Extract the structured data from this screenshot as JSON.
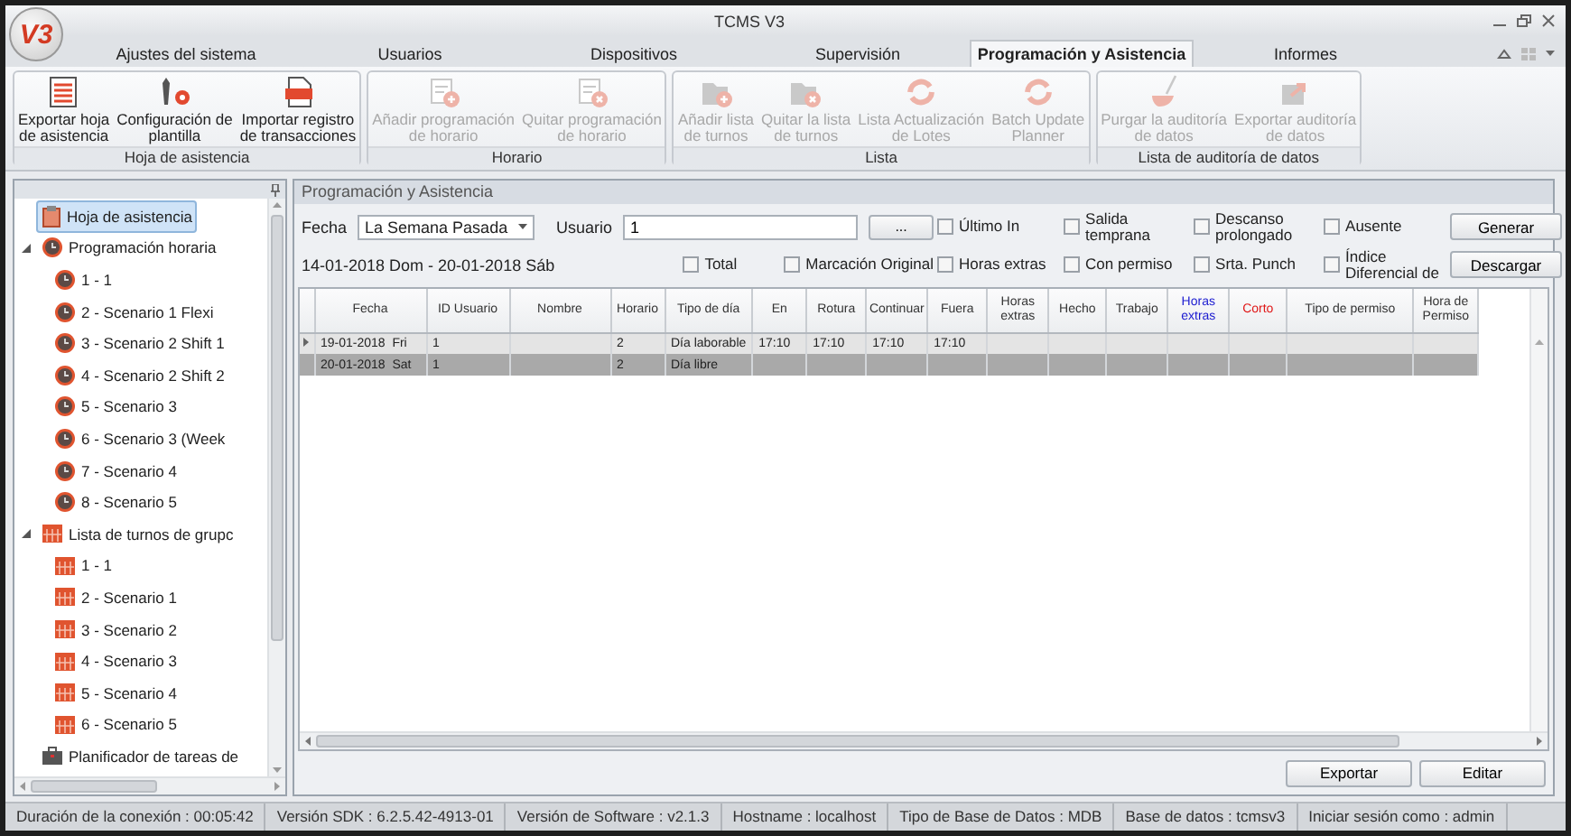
{
  "window": {
    "logo": "V3",
    "title": "TCMS V3"
  },
  "tabs": [
    {
      "label": "Ajustes del sistema",
      "selected": false
    },
    {
      "label": "Usuarios",
      "selected": false
    },
    {
      "label": "Dispositivos",
      "selected": false
    },
    {
      "label": "Supervisión",
      "selected": false
    },
    {
      "label": "Programación y Asistencia",
      "selected": true
    },
    {
      "label": "Informes",
      "selected": false
    }
  ],
  "ribbon": [
    {
      "label": "Hoja de asistencia",
      "buttons": [
        {
          "lines": [
            "Exportar hoja",
            "de asistencia"
          ],
          "kind": "sheet",
          "disabled": false
        },
        {
          "lines": [
            "Configuración de",
            "plantilla"
          ],
          "kind": "tools",
          "disabled": false
        },
        {
          "lines": [
            "Importar registro",
            "de transacciones"
          ],
          "kind": "log",
          "disabled": false
        }
      ]
    },
    {
      "label": "Horario",
      "buttons": [
        {
          "lines": [
            "Añadir programación",
            "de horario"
          ],
          "kind": "doc-add",
          "disabled": true
        },
        {
          "lines": [
            "Quitar programación",
            "de horario"
          ],
          "kind": "doc-remove",
          "disabled": true
        }
      ]
    },
    {
      "label": "Lista",
      "buttons": [
        {
          "lines": [
            "Añadir lista",
            "de turnos"
          ],
          "kind": "folder-add",
          "disabled": true
        },
        {
          "lines": [
            "Quitar la lista",
            "de turnos"
          ],
          "kind": "folder-remove",
          "disabled": true
        },
        {
          "lines": [
            "Lista Actualización",
            "de Lotes"
          ],
          "kind": "refresh",
          "disabled": true
        },
        {
          "lines": [
            "Batch Update",
            "Planner"
          ],
          "kind": "refresh",
          "disabled": true
        }
      ]
    },
    {
      "label": "Lista de auditoría de datos",
      "buttons": [
        {
          "lines": [
            "Purgar la auditoría",
            "de datos"
          ],
          "kind": "broom",
          "disabled": true
        },
        {
          "lines": [
            "Exportar auditoría",
            "de datos"
          ],
          "kind": "export",
          "disabled": true
        }
      ]
    }
  ],
  "sidebar": {
    "items": [
      {
        "label": "Hoja de asistencia",
        "kind": "sheet",
        "selected": true
      },
      {
        "label": "Programación horaria",
        "kind": "clock",
        "selected": false,
        "expanded": true,
        "children": [
          {
            "label": "1 - 1",
            "kind": "clock",
            "selected": false
          },
          {
            "label": "2 - Scenario 1 Flexi",
            "kind": "clock",
            "selected": false
          },
          {
            "label": "3 - Scenario 2 Shift 1",
            "kind": "clock",
            "selected": false
          },
          {
            "label": "4 - Scenario 2 Shift 2",
            "kind": "clock",
            "selected": false
          },
          {
            "label": "5 - Scenario 3",
            "kind": "clock",
            "selected": false
          },
          {
            "label": "6 - Scenario 3 (Week",
            "kind": "clock",
            "selected": false
          },
          {
            "label": "7 - Scenario 4",
            "kind": "clock",
            "selected": false
          },
          {
            "label": "8 - Scenario 5",
            "kind": "clock",
            "selected": false
          }
        ]
      },
      {
        "label": "Lista de turnos de grupc",
        "kind": "calendar",
        "selected": false,
        "expanded": true,
        "children": [
          {
            "label": "1 - 1",
            "kind": "calendar",
            "selected": false
          },
          {
            "label": "2 - Scenario 1",
            "kind": "calendar",
            "selected": false
          },
          {
            "label": "3 - Scenario 2",
            "kind": "calendar",
            "selected": false
          },
          {
            "label": "4 - Scenario 3",
            "kind": "calendar",
            "selected": false
          },
          {
            "label": "5 - Scenario 4",
            "kind": "calendar",
            "selected": false
          },
          {
            "label": "6 - Scenario 5",
            "kind": "calendar",
            "selected": false
          }
        ]
      },
      {
        "label": "Planificador de tareas de",
        "kind": "briefcase",
        "selected": false
      }
    ]
  },
  "panel": {
    "title": "Programación y Asistencia",
    "filters": {
      "fecha_label": "Fecha",
      "fecha_value": "La Semana Pasada",
      "usuario_label": "Usuario",
      "usuario_value": "1",
      "browse_button": "...",
      "date_range": "14-01-2018 Dom - 20-01-2018 Sáb",
      "checkboxes": [
        {
          "label": "Último In",
          "checked": false
        },
        {
          "label": "Salida temprana",
          "checked": false
        },
        {
          "label": "Descanso prolongado",
          "checked": false
        },
        {
          "label": "Ausente",
          "checked": false
        },
        {
          "label": "Total",
          "checked": false
        },
        {
          "label": "Marcación Original",
          "checked": false
        },
        {
          "label": "Horas extras",
          "checked": false
        },
        {
          "label": "Con permiso",
          "checked": false
        },
        {
          "label": "Srta. Punch",
          "checked": false
        },
        {
          "label": "Índice Diferencial de",
          "checked": false
        }
      ],
      "buttons": [
        "Generar",
        "Descargar"
      ]
    },
    "table": {
      "columns": [
        {
          "label": "Fecha"
        },
        {
          "label": "ID Usuario"
        },
        {
          "label": "Nombre"
        },
        {
          "label": "Horario"
        },
        {
          "label": "Tipo de día"
        },
        {
          "label": "En"
        },
        {
          "label": "Rotura"
        },
        {
          "label": "Continuar"
        },
        {
          "label": "Fuera"
        },
        {
          "label": "Horas extras"
        },
        {
          "label": "Hecho"
        },
        {
          "label": "Trabajo"
        },
        {
          "label": "Horas extras",
          "color": "#1a1ad0"
        },
        {
          "label": "Corto",
          "color": "#e01818"
        },
        {
          "label": "Tipo de permiso"
        },
        {
          "label": "Hora de Permiso"
        }
      ],
      "rows": [
        {
          "current": true,
          "selected": false,
          "fecha": "19-01-2018  Fri",
          "id": "1",
          "horario": "2",
          "tipo": "Día laborable",
          "en": "17:10",
          "rotura": "17:10",
          "continuar": "17:10",
          "fuera": "17:10"
        },
        {
          "current": false,
          "selected": true,
          "fecha": "20-01-2018  Sat",
          "id": "1",
          "horario": "2",
          "tipo": "Día libre"
        }
      ]
    },
    "buttons": [
      "Exportar",
      "Editar"
    ]
  },
  "status_bar": [
    "Duración de la conexión : 00:05:42",
    "Versión SDK : 6.2.5.42-4913-01",
    "Versión de Software : v2.1.3",
    "Hostname : localhost",
    "Tipo de Base de Datos : MDB",
    "Base de datos : tcmsv3",
    "Iniciar sesión como : admin"
  ]
}
